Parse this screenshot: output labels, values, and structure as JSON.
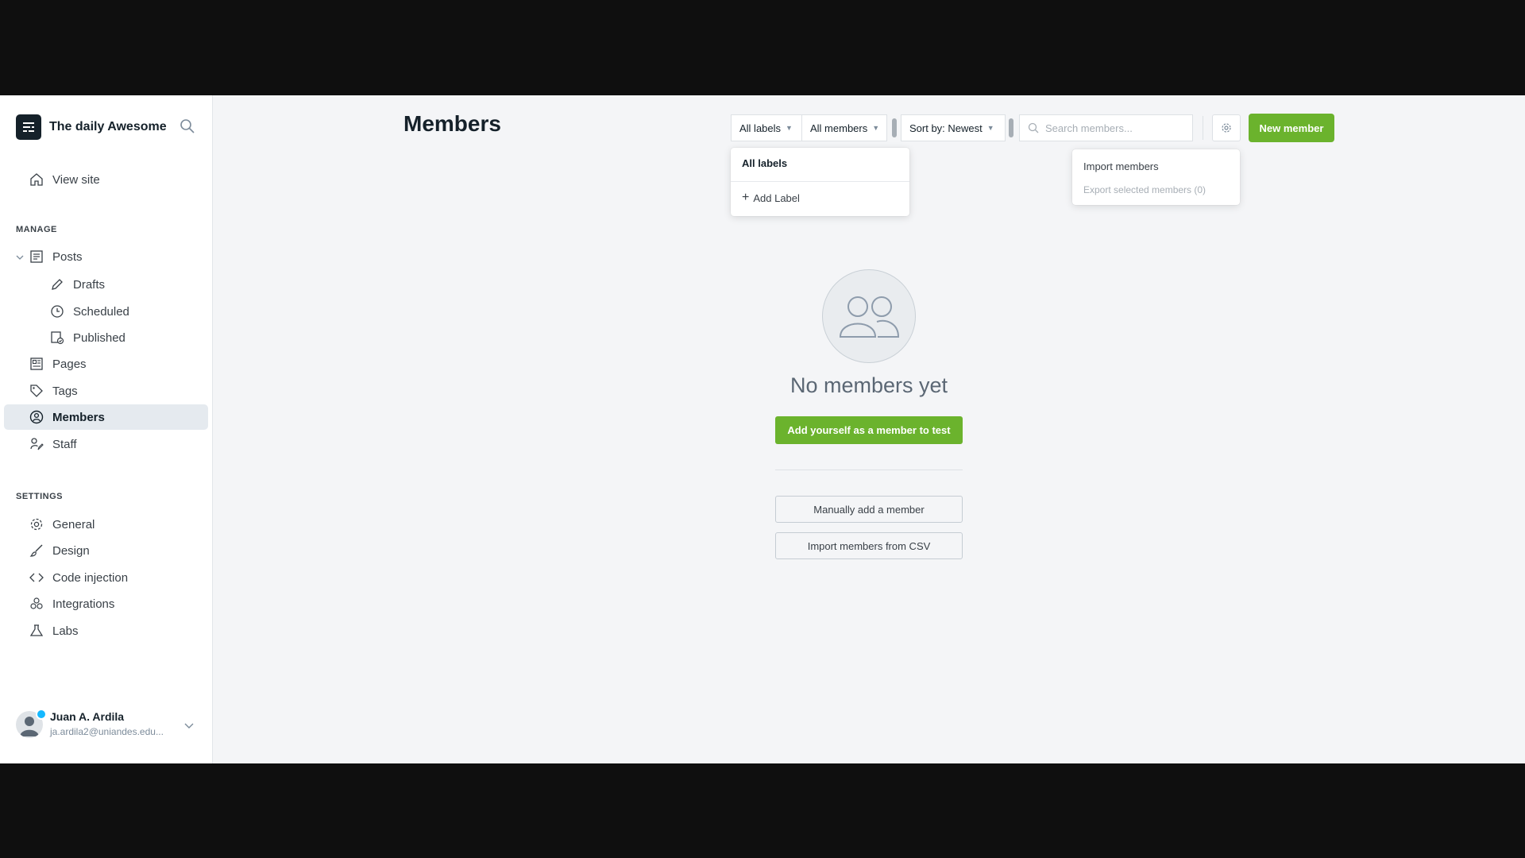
{
  "sidebar": {
    "brand_title": "The daily Awesome",
    "view_site": "View site",
    "manage_title": "MANAGE",
    "settings_title": "SETTINGS",
    "manage_items": {
      "posts": "Posts",
      "drafts": "Drafts",
      "scheduled": "Scheduled",
      "published": "Published",
      "pages": "Pages",
      "tags": "Tags",
      "members": "Members",
      "staff": "Staff"
    },
    "settings_items": {
      "general": "General",
      "design": "Design",
      "code_injection": "Code injection",
      "integrations": "Integrations",
      "labs": "Labs"
    },
    "active_item": "Members",
    "user": {
      "name": "Juan A. Ardila",
      "email": "ja.ardila2@uniandes.edu..."
    }
  },
  "header": {
    "title": "Members",
    "filter_labels": "All labels",
    "filter_members": "All members",
    "sort": "Sort by: Newest",
    "search_placeholder": "Search members...",
    "new_member": "New member"
  },
  "labels_dropdown": {
    "heading": "All labels",
    "add_label": "Add Label"
  },
  "actions_dropdown": {
    "import": "Import members",
    "export": "Export selected members (0)"
  },
  "empty_state": {
    "title": "No members yet",
    "add_self": "Add yourself as a member to test",
    "manual_add": "Manually add a member",
    "import_csv": "Import members from CSV"
  },
  "colors": {
    "accent_green": "#6bb32d",
    "sidebar_active": "#e5eaef",
    "online_dot": "#14b8ff"
  }
}
